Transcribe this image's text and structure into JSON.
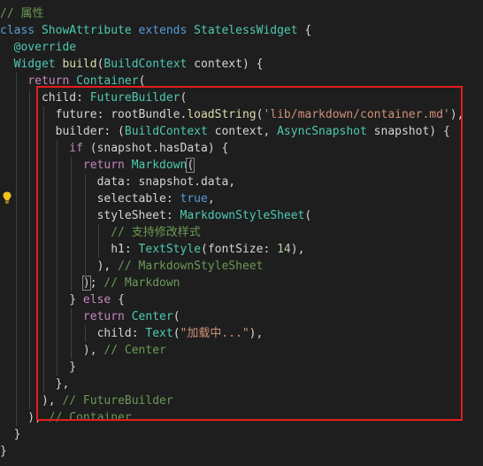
{
  "editor": {
    "lines": [
      [
        {
          "t": "// 属性",
          "c": "cm"
        }
      ],
      [
        {
          "t": "class ",
          "c": "k"
        },
        {
          "t": "ShowAttribute ",
          "c": "cl"
        },
        {
          "t": "extends ",
          "c": "k"
        },
        {
          "t": "StatelessWidget ",
          "c": "cl"
        },
        {
          "t": "{",
          "c": ""
        }
      ],
      [
        {
          "t": "  @override",
          "c": "an"
        }
      ],
      [
        {
          "t": "  Widget ",
          "c": "cl"
        },
        {
          "t": "build",
          "c": "f"
        },
        {
          "t": "(",
          "c": ""
        },
        {
          "t": "BuildContext ",
          "c": "cl"
        },
        {
          "t": "context) {",
          "c": ""
        }
      ],
      [
        {
          "t": "    ",
          "c": ""
        },
        {
          "t": "return ",
          "c": "c"
        },
        {
          "t": "Container",
          "c": "cl"
        },
        {
          "t": "(",
          "c": ""
        }
      ],
      [
        {
          "t": "      child: ",
          "c": ""
        },
        {
          "t": "FutureBuilder",
          "c": "cl"
        },
        {
          "t": "(",
          "c": ""
        }
      ],
      [
        {
          "t": "        future: rootBundle.",
          "c": ""
        },
        {
          "t": "loadString",
          "c": "f"
        },
        {
          "t": "(",
          "c": ""
        },
        {
          "t": "'lib/markdown/container.md'",
          "c": "s"
        },
        {
          "t": "),",
          "c": ""
        }
      ],
      [
        {
          "t": "        builder: (",
          "c": ""
        },
        {
          "t": "BuildContext ",
          "c": "cl"
        },
        {
          "t": "context, ",
          "c": ""
        },
        {
          "t": "AsyncSnapshot ",
          "c": "cl"
        },
        {
          "t": "snapshot) {",
          "c": ""
        }
      ],
      [
        {
          "t": "          ",
          "c": ""
        },
        {
          "t": "if ",
          "c": "c"
        },
        {
          "t": "(snapshot.hasData) {",
          "c": ""
        }
      ],
      [
        {
          "t": "            ",
          "c": ""
        },
        {
          "t": "return ",
          "c": "c"
        },
        {
          "t": "Markdown",
          "c": "cl"
        },
        {
          "t": "(",
          "c": "br"
        }
      ],
      [
        {
          "t": "              data: snapshot.data,",
          "c": ""
        }
      ],
      [
        {
          "t": "              selectable: ",
          "c": ""
        },
        {
          "t": "true",
          "c": "k"
        },
        {
          "t": ",",
          "c": ""
        }
      ],
      [
        {
          "t": "              styleSheet: ",
          "c": ""
        },
        {
          "t": "MarkdownStyleSheet",
          "c": "cl"
        },
        {
          "t": "(",
          "c": ""
        }
      ],
      [
        {
          "t": "                ",
          "c": ""
        },
        {
          "t": "// 支持修改样式",
          "c": "cm"
        }
      ],
      [
        {
          "t": "                h1: ",
          "c": ""
        },
        {
          "t": "TextStyle",
          "c": "cl"
        },
        {
          "t": "(fontSize: ",
          "c": ""
        },
        {
          "t": "14",
          "c": "n"
        },
        {
          "t": "),",
          "c": ""
        }
      ],
      [
        {
          "t": "              ), ",
          "c": ""
        },
        {
          "t": "// MarkdownStyleSheet",
          "c": "cm"
        }
      ],
      [
        {
          "t": "            ",
          "c": ""
        },
        {
          "t": ")",
          "c": "br"
        },
        {
          "t": "; ",
          "c": ""
        },
        {
          "t": "// Markdown",
          "c": "cm"
        }
      ],
      [
        {
          "t": "          } ",
          "c": ""
        },
        {
          "t": "else ",
          "c": "c"
        },
        {
          "t": "{",
          "c": ""
        }
      ],
      [
        {
          "t": "            ",
          "c": ""
        },
        {
          "t": "return ",
          "c": "c"
        },
        {
          "t": "Center",
          "c": "cl"
        },
        {
          "t": "(",
          "c": ""
        }
      ],
      [
        {
          "t": "              child: ",
          "c": ""
        },
        {
          "t": "Text",
          "c": "cl"
        },
        {
          "t": "(",
          "c": ""
        },
        {
          "t": "\"加载中...\"",
          "c": "s"
        },
        {
          "t": "),",
          "c": ""
        }
      ],
      [
        {
          "t": "            ), ",
          "c": ""
        },
        {
          "t": "// Center",
          "c": "cm"
        }
      ],
      [
        {
          "t": "          }",
          "c": ""
        }
      ],
      [
        {
          "t": "        },",
          "c": ""
        }
      ],
      [
        {
          "t": "      ), ",
          "c": ""
        },
        {
          "t": "// FutureBuilder",
          "c": "cm"
        }
      ],
      [
        {
          "t": "    ), ",
          "c": ""
        },
        {
          "t": "// Container",
          "c": "cm"
        }
      ],
      [
        {
          "t": "  }",
          "c": ""
        }
      ],
      [
        {
          "t": "}",
          "c": ""
        }
      ]
    ]
  },
  "colors": {
    "background": "#1e1e1e",
    "highlight_box": "#e51d1d",
    "lightbulb": "#f0c419"
  },
  "icons": {
    "gutter": "lightbulb-icon"
  }
}
